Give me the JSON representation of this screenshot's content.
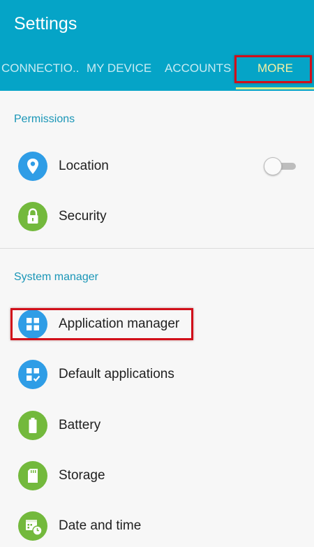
{
  "header": {
    "title": "Settings",
    "tabs": [
      {
        "label": "CONNECTIO..",
        "active": false
      },
      {
        "label": "MY DEVICE",
        "active": false
      },
      {
        "label": "ACCOUNTS",
        "active": false
      },
      {
        "label": "MORE",
        "active": true
      }
    ]
  },
  "sections": [
    {
      "label": "Permissions",
      "items": [
        {
          "label": "Location",
          "icon": "location-pin-icon",
          "color": "#2f9de6",
          "toggle": {
            "on": false
          }
        },
        {
          "label": "Security",
          "icon": "lock-icon",
          "color": "#73b93c"
        }
      ]
    },
    {
      "label": "System manager",
      "items": [
        {
          "label": "Application manager",
          "icon": "grid-icon",
          "color": "#2f9de6",
          "highlighted": true
        },
        {
          "label": "Default applications",
          "icon": "grid-check-icon",
          "color": "#2f9de6"
        },
        {
          "label": "Battery",
          "icon": "battery-icon",
          "color": "#73b93c"
        },
        {
          "label": "Storage",
          "icon": "sd-card-icon",
          "color": "#73b93c"
        },
        {
          "label": "Date and time",
          "icon": "calendar-clock-icon",
          "color": "#73b93c"
        }
      ]
    }
  ],
  "colors": {
    "header_bg": "#05a4c7",
    "tab_active": "#f4f0a3",
    "tab_indicator": "#d9ec85",
    "section_label": "#1a96b7",
    "highlight_box": "#d10f1a"
  }
}
